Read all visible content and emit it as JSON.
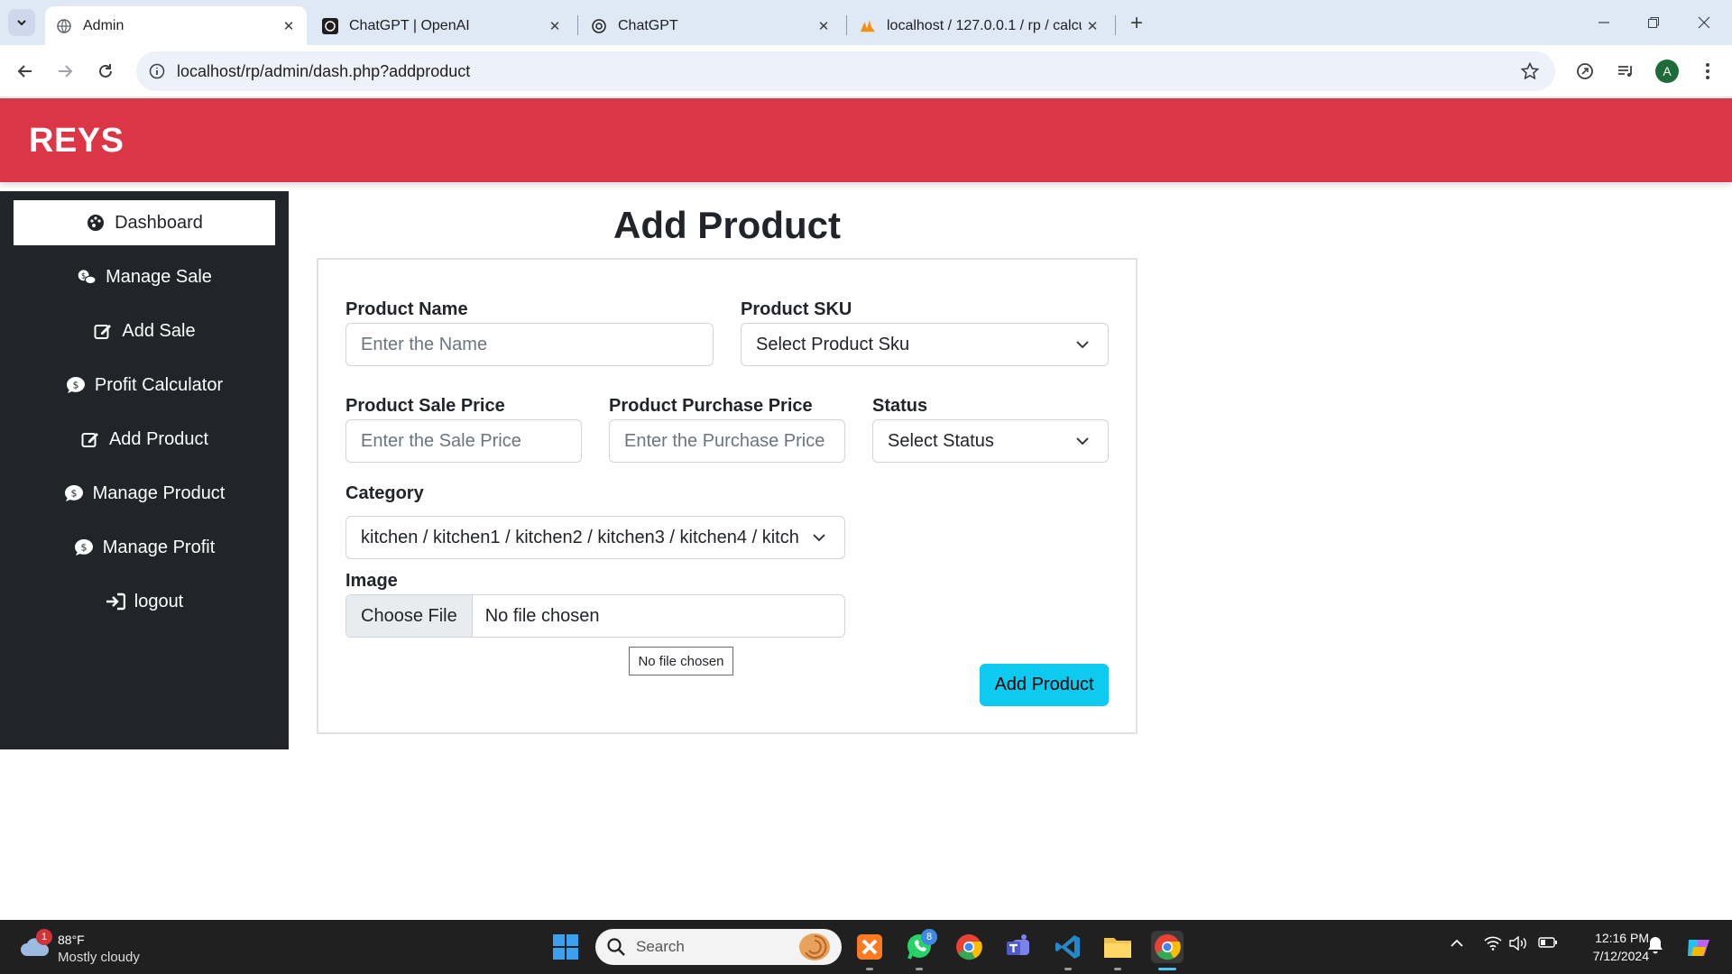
{
  "browser": {
    "tabs": [
      {
        "title": "Admin",
        "active": true
      },
      {
        "title": "ChatGPT | OpenAI",
        "active": false
      },
      {
        "title": "ChatGPT",
        "active": false
      },
      {
        "title": "localhost / 127.0.0.1 / rp / calcu",
        "active": false
      }
    ],
    "url": "localhost/rp/admin/dash.php?addproduct",
    "profile_initial": "A"
  },
  "header": {
    "brand": "REYS",
    "color": "#dc3545"
  },
  "sidebar": {
    "items": [
      {
        "label": "Dashboard",
        "icon": "palette-icon",
        "active": true
      },
      {
        "label": "Manage Sale",
        "icon": "coins-icon"
      },
      {
        "label": "Add Sale",
        "icon": "edit-icon"
      },
      {
        "label": "Profit Calculator",
        "icon": "dollar-comment-icon"
      },
      {
        "label": "Add Product",
        "icon": "edit-icon"
      },
      {
        "label": "Manage Product",
        "icon": "dollar-comment-icon"
      },
      {
        "label": "Manage Profit",
        "icon": "dollar-comment-icon"
      },
      {
        "label": "logout",
        "icon": "sign-in-icon"
      }
    ]
  },
  "form": {
    "title": "Add Product",
    "product_name": {
      "label": "Product Name",
      "placeholder": "Enter the Name"
    },
    "product_sku": {
      "label": "Product SKU",
      "value": "Select Product Sku"
    },
    "sale_price": {
      "label": "Product Sale Price",
      "placeholder": "Enter the Sale Price"
    },
    "purchase_price": {
      "label": "Product Purchase Price",
      "placeholder": "Enter the Purchase Price"
    },
    "status": {
      "label": "Status",
      "value": "Select Status"
    },
    "category": {
      "label": "Category",
      "value": "kitchen / kitchen1 / kitchen2 / kitchen3 / kitchen4 / kitch"
    },
    "image": {
      "label": "Image",
      "button": "Choose File",
      "text": "No file chosen"
    },
    "tooltip": "No file chosen",
    "submit": "Add Product",
    "submit_color": "#0dcaf0"
  },
  "taskbar": {
    "weather_temp": "88°F",
    "weather_cond": "Mostly cloudy",
    "weather_badge": "1",
    "search_text": "Search",
    "whatsapp_badge": "8",
    "time": "12:16 PM",
    "date": "7/12/2024"
  }
}
